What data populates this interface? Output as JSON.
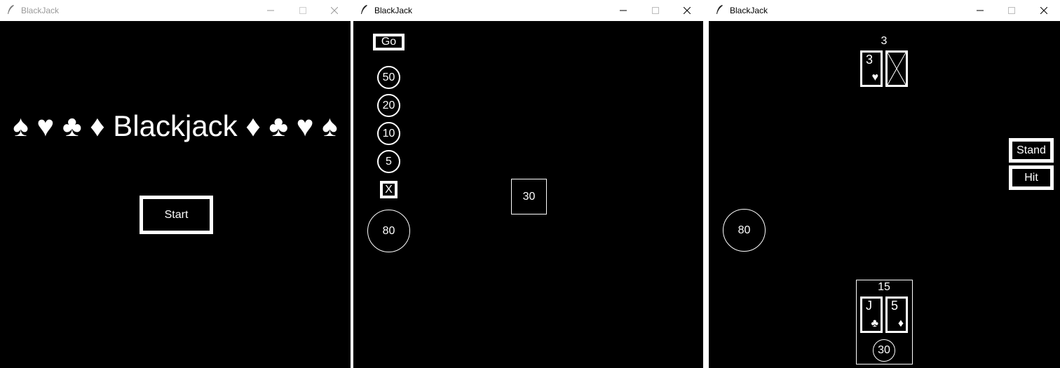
{
  "windows": [
    {
      "title": "BlackJack",
      "banner": "♠ ♥ ♣ ♦ Blackjack ♦ ♣ ♥ ♠",
      "start_label": "Start"
    },
    {
      "title": "BlackJack",
      "go_label": "Go",
      "chips": [
        "50",
        "20",
        "10",
        "5"
      ],
      "clear_label": "X",
      "bank": "80",
      "bet": "30"
    },
    {
      "title": "BlackJack",
      "dealer_total": "3",
      "dealer_cards": [
        {
          "rank": "3",
          "suit": "♥"
        }
      ],
      "stand_label": "Stand",
      "hit_label": "Hit",
      "bank": "80",
      "player_total": "15",
      "player_cards": [
        {
          "rank": "J",
          "suit": "♣"
        },
        {
          "rank": "5",
          "suit": "♦"
        }
      ],
      "player_bet": "30"
    }
  ]
}
